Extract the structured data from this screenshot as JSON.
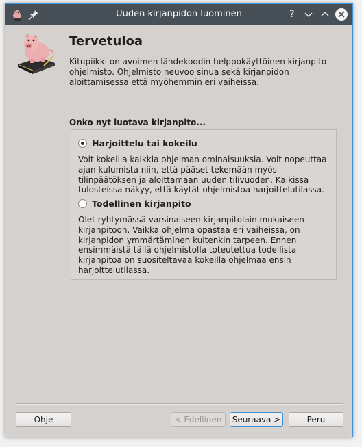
{
  "window": {
    "title": "Uuden kirjanpidon luominen",
    "accent": "#3d8fd6",
    "titlebar_color": "#475057"
  },
  "titlebar_buttons": {
    "help": "?",
    "minimize": "⌵",
    "maximize": "^",
    "close": "✕"
  },
  "page": {
    "heading": "Tervetuloa",
    "intro": "Kitupiikki on avoimen lähdekoodin helppokäyttöinen kirjanpito-ohjelmisto. Ohjelmisto neuvoo sinua sekä kirjanpidon aloittamisessa että myöhemmin eri vaiheissa.",
    "question": "Onko nyt luotava kirjanpito..."
  },
  "options": [
    {
      "label": "Harjoittelu tai kokeilu",
      "checked": true,
      "description": "Voit kokeilla kaikkia ohjelman ominaisuuksia. Voit nopeuttaa ajan kulumista niin, että pääset tekemään myös tilinpäätöksen ja aloittamaan uuden tilivuoden. Kaikissa tulosteissa näkyy, että käytät ohjelmistoa harjoittelutilassa."
    },
    {
      "label": "Todellinen kirjanpito",
      "checked": false,
      "description": "Olet ryhtymässä varsinaiseen kirjanpitolain mukaiseen kirjanpitoon. Vaikka ohjelma opastaa eri vaiheissa, on kirjanpidon ymmärtäminen kuitenkin tarpeen. Ennen ensimmäistä tällä ohjelmistolla toteutettua todellista kirjanpitoa on suositeltavaa kokeilla ohjelmaa ensin harjoittelutilassa."
    }
  ],
  "buttons": {
    "help": "Ohje",
    "back": "< Edellinen",
    "next": "Seuraava >",
    "cancel": "Peru"
  }
}
